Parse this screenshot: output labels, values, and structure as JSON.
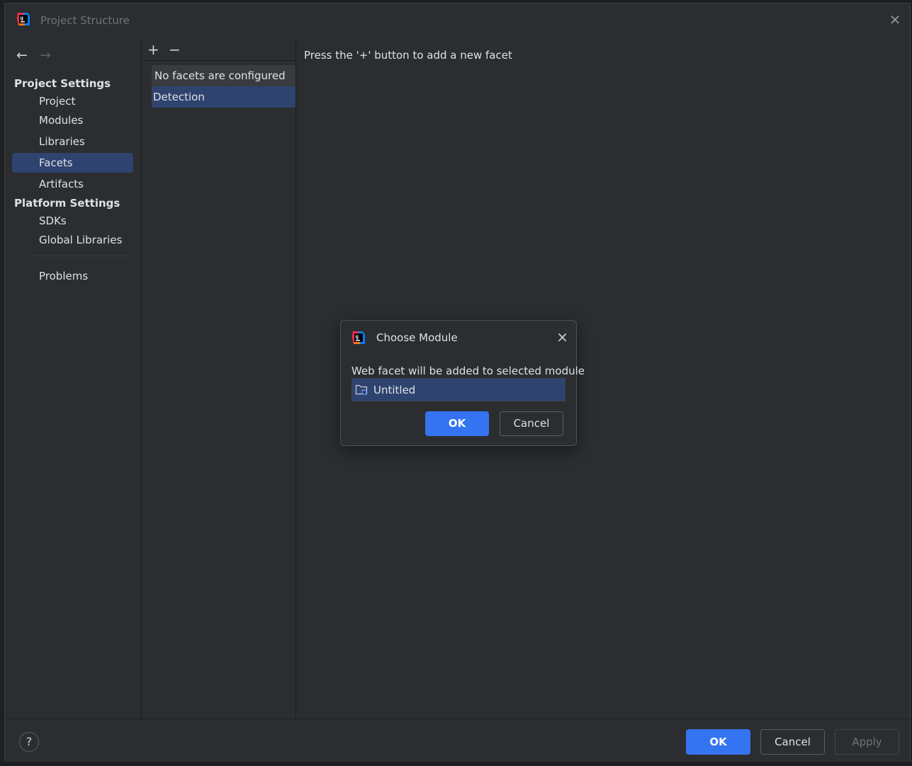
{
  "window": {
    "title": "Project Structure"
  },
  "sidebar": {
    "nav_back": "←",
    "nav_forward": "→",
    "project_settings_header": "Project Settings",
    "project_items": [
      {
        "label": "Project"
      },
      {
        "label": "Modules"
      },
      {
        "label": "Libraries"
      },
      {
        "label": "Facets",
        "selected": true
      },
      {
        "label": "Artifacts"
      }
    ],
    "platform_settings_header": "Platform Settings",
    "platform_items": [
      {
        "label": "SDKs"
      },
      {
        "label": "Global Libraries"
      }
    ],
    "problems": "Problems"
  },
  "facets_panel": {
    "add_icon": "+",
    "remove_icon": "−",
    "empty_text": "No facets are configured",
    "detection": "Detection"
  },
  "content": {
    "hint": "Press the '+' button to add a new facet"
  },
  "bottom": {
    "help": "?",
    "ok": "OK",
    "cancel": "Cancel",
    "apply": "Apply"
  },
  "dialog": {
    "title": "Choose Module",
    "close": "×",
    "message": "Web facet will be added to selected module",
    "modules": [
      {
        "label": "Untitled",
        "selected": true
      }
    ],
    "ok": "OK",
    "cancel": "Cancel"
  },
  "colors": {
    "accent": "#3574f0",
    "selection": "#2e436e",
    "background": "#2b2d30"
  }
}
